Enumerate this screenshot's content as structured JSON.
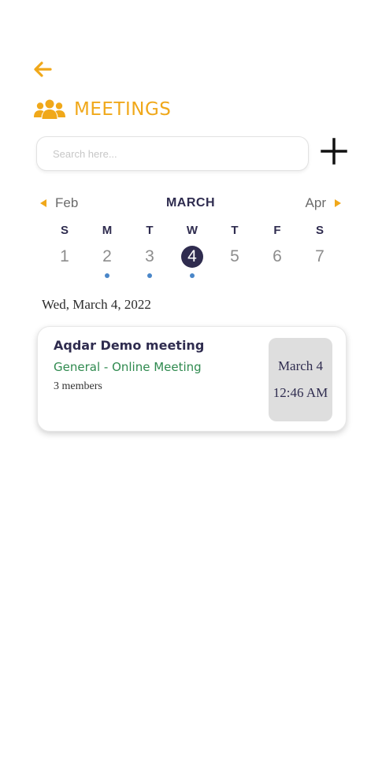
{
  "header": {
    "back_icon": "arrow-left-icon",
    "title_icon": "people-group-icon",
    "title": "MEETINGS",
    "accent_color": "#f0a81a"
  },
  "search": {
    "placeholder": "Search here...",
    "value": ""
  },
  "add_button": {
    "icon": "plus-icon"
  },
  "calendar": {
    "prev_month": "Feb",
    "current_month": "MARCH",
    "next_month": "Apr",
    "weekdays": [
      "S",
      "M",
      "T",
      "W",
      "T",
      "F",
      "S"
    ],
    "dates": [
      {
        "day": "1",
        "has_event": false,
        "selected": false
      },
      {
        "day": "2",
        "has_event": true,
        "selected": false
      },
      {
        "day": "3",
        "has_event": true,
        "selected": false
      },
      {
        "day": "4",
        "has_event": true,
        "selected": true
      },
      {
        "day": "5",
        "has_event": false,
        "selected": false
      },
      {
        "day": "6",
        "has_event": false,
        "selected": false
      },
      {
        "day": "7",
        "has_event": false,
        "selected": false
      }
    ],
    "selected_color": "#2f2c4f",
    "event_dot_color": "#4a86c8"
  },
  "selected_date_label": "Wed, March 4, 2022",
  "meetings": [
    {
      "title": "Aqdar Demo meeting",
      "type": "General - Online Meeting",
      "members": "3 members",
      "date": "March 4",
      "time": "12:46 AM"
    }
  ]
}
